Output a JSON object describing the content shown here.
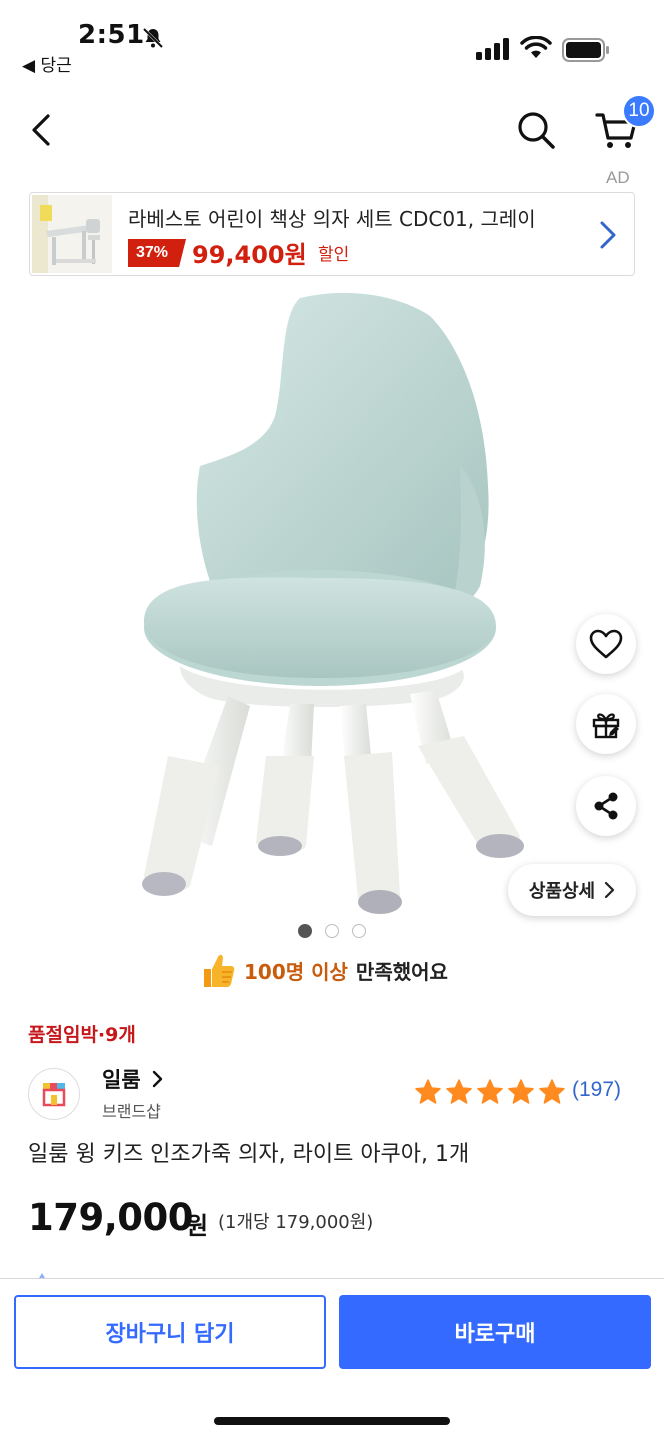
{
  "status_bar": {
    "time": "2:51",
    "back_app": "◀ 당근"
  },
  "nav": {
    "cart_count": "10"
  },
  "ad": {
    "label": "AD",
    "title": "라베스토 어린이 책상 의자 세트 CDC01, 그레이",
    "discount": "37%",
    "price": "99,400원",
    "sale_text": "할인"
  },
  "gallery": {
    "total_images": 3,
    "current_index": 1,
    "detail_label": "상품상세"
  },
  "satisfaction": {
    "highlight": "100명 이상",
    "rest": "만족했어요"
  },
  "stock": {
    "text": "품절임박·9개"
  },
  "brand": {
    "name": "일룸",
    "sub": "브랜드샵"
  },
  "rating": {
    "stars": 5,
    "count": "(197)"
  },
  "product": {
    "title": "일룸 윙 키즈 인조가죽 의자, 라이트 아쿠아, 1개",
    "price": "179,000",
    "price_unit": "원",
    "unit_price": "(1개당 179,000원)"
  },
  "actions": {
    "add_to_cart": "장바구니 담기",
    "buy_now": "바로구매"
  },
  "colors": {
    "accent": "#346aff",
    "sale_red": "#d2200f",
    "star": "#ff8a1f"
  }
}
